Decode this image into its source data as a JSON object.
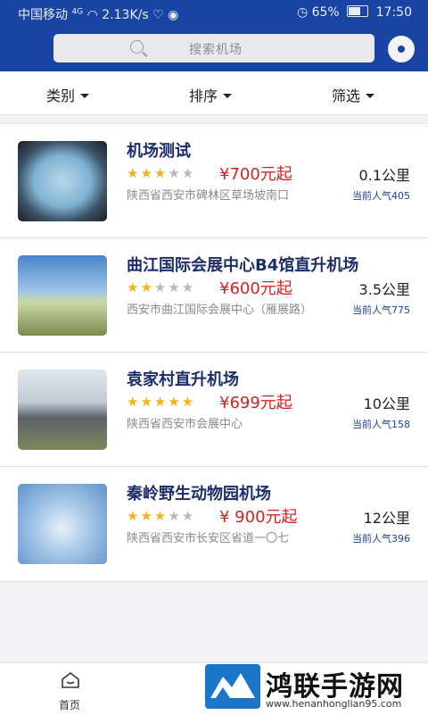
{
  "status_bar": {
    "carrier": "中国移动",
    "net": "4G",
    "speed": "2.13K/s",
    "battery": "65%",
    "time": "17:50"
  },
  "search": {
    "placeholder": "搜索机场"
  },
  "filters": {
    "category": "类别",
    "sort": "排序",
    "filter": "筛选"
  },
  "airports": [
    {
      "name": "机场测试",
      "rating": 3,
      "price": "¥700元起",
      "distance": "0.1公里",
      "address": "陕西省西安市碑林区草场坡南口",
      "popularity": "当前人气405"
    },
    {
      "name": "曲江国际会展中心B4馆直升机场",
      "rating": 2,
      "price": "¥600元起",
      "distance": "3.5公里",
      "address": "西安市曲江国际会展中心（雁展路）",
      "popularity": "当前人气775"
    },
    {
      "name": "袁家村直升机场",
      "rating": 5,
      "price": "¥699元起",
      "distance": "10公里",
      "address": "陕西省西安市会展中心",
      "popularity": "当前人气158"
    },
    {
      "name": "秦岭野生动物园机场",
      "rating": 3,
      "price": "¥ 900元起",
      "distance": "12公里",
      "address": "陕西省西安市长安区省道一〇七",
      "popularity": "当前人气396"
    }
  ],
  "tabbar": {
    "home": "首页"
  },
  "watermark": {
    "title": "鸿联手游网",
    "url": "www.henanhonglian95.com"
  },
  "colors": {
    "primary": "#1a44a4",
    "price": "#d32222",
    "star": "#f2b21d"
  }
}
